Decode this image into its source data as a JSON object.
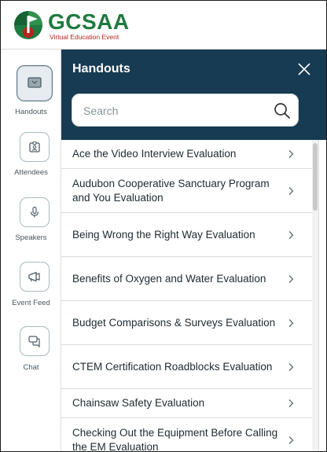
{
  "brand": {
    "name": "GCSAA",
    "subtitle": "Virtual Education Event",
    "colors": {
      "green": "#1f7a3f",
      "red": "#b3261e",
      "navy": "#173b52"
    }
  },
  "rail": {
    "items": [
      {
        "label": "Handouts",
        "icon": "bag-icon",
        "active": true
      },
      {
        "label": "Attendees",
        "icon": "badge-icon",
        "active": false
      },
      {
        "label": "Speakers",
        "icon": "microphone-icon",
        "active": false
      },
      {
        "label": "Event Feed",
        "icon": "megaphone-icon",
        "active": false
      },
      {
        "label": "Chat",
        "icon": "chat-icon",
        "active": false
      }
    ]
  },
  "panel": {
    "title": "Handouts",
    "search_placeholder": "Search",
    "items": [
      {
        "label": "Ace the Video Interview Evaluation"
      },
      {
        "label": "Audubon Cooperative Sanctuary Program and You Evaluation"
      },
      {
        "label": "Being Wrong the Right Way Evaluation"
      },
      {
        "label": "Benefits of Oxygen and Water Evaluation"
      },
      {
        "label": "Budget Comparisons & Surveys Evaluation"
      },
      {
        "label": "CTEM Certification Roadblocks Evaluation"
      },
      {
        "label": "Chainsaw Safety Evaluation"
      },
      {
        "label": "Checking Out the Equipment Before Calling the EM Evaluation"
      }
    ]
  }
}
